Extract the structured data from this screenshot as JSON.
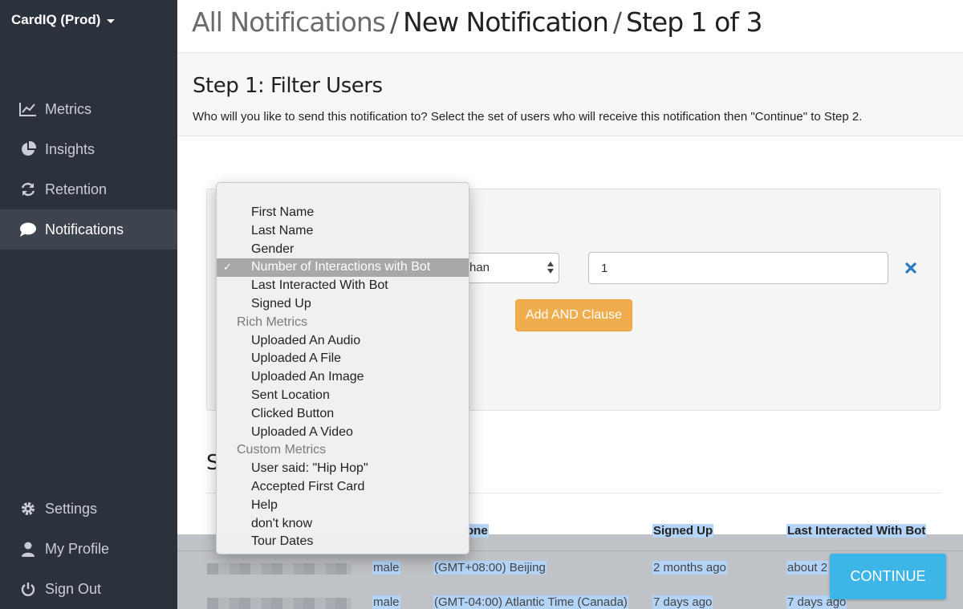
{
  "org": {
    "name": "CardIQ (Prod)"
  },
  "sidebar": {
    "items": [
      {
        "label": "Metrics",
        "icon": "line-chart-icon"
      },
      {
        "label": "Insights",
        "icon": "pie-chart-icon"
      },
      {
        "label": "Retention",
        "icon": "refresh-icon"
      },
      {
        "label": "Notifications",
        "icon": "comment-icon",
        "active": true
      }
    ],
    "bottom": [
      {
        "label": "Settings",
        "icon": "gear-icon"
      },
      {
        "label": "My Profile",
        "icon": "user-icon"
      },
      {
        "label": "Sign Out",
        "icon": "power-icon"
      }
    ]
  },
  "breadcrumb": {
    "link": "All Notifications",
    "sep": "/",
    "current": "New Notification",
    "step": "Step 1 of 3"
  },
  "step": {
    "title": "Step 1: Filter Users",
    "description": "Who will you like to send this notification to? Select the set of users who will receive this notification then \"Continue\" to Step 2."
  },
  "filter": {
    "operator_visible": "han",
    "value": "1",
    "add_and_label": "Add AND Clause"
  },
  "dropdown": {
    "items": [
      "First Name",
      "Last Name",
      "Gender",
      "Number of Interactions with Bot",
      "Last Interacted With Bot",
      "Signed Up"
    ],
    "selected_index": 3,
    "check": "✓",
    "groups": [
      {
        "label": "Rich Metrics",
        "items": [
          "Uploaded An Audio",
          "Uploaded A File",
          "Uploaded An Image",
          "Sent Location",
          "Clicked Button",
          "Uploaded A Video"
        ]
      },
      {
        "label": "Custom Metrics",
        "items": [
          "User said: \"Hip Hop\"",
          "Accepted First Card",
          "Help",
          "don't know",
          "Tour Dates"
        ]
      }
    ]
  },
  "users": {
    "heading_visible": "S",
    "columns": [
      "one",
      "Signed Up",
      "Last Interacted With Bot"
    ],
    "rows": [
      {
        "gender": "male",
        "timezone": "(GMT+08:00) Beijing",
        "signed_up": "2 months ago",
        "last": "about 2"
      },
      {
        "gender": "male",
        "timezone": "(GMT-04:00) Atlantic Time (Canada)",
        "signed_up": "7 days ago",
        "last": "7 days ago"
      }
    ]
  },
  "actions": {
    "continue_label": "CONTINUE"
  },
  "colors": {
    "sidebar": "#2c323b",
    "accent_orange": "#f0ad4e",
    "accent_blue": "#3db5e6",
    "remove_x": "#2a7bc4"
  }
}
